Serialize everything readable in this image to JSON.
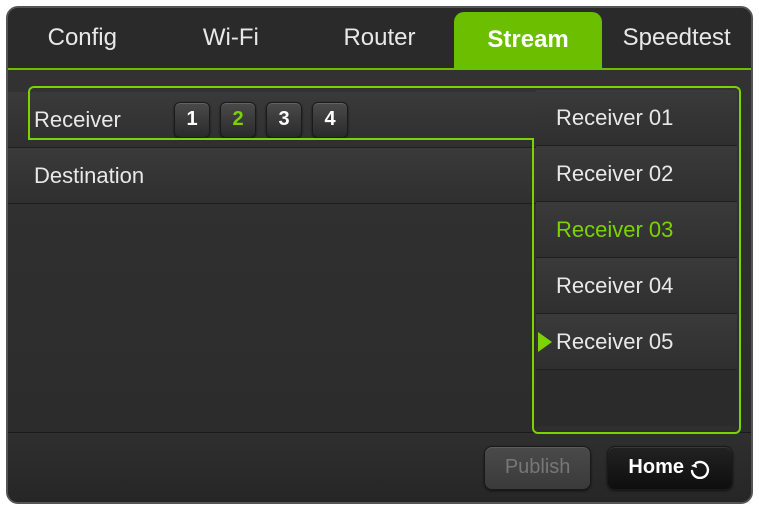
{
  "tabs": [
    {
      "label": "Config",
      "active": false
    },
    {
      "label": "Wi-Fi",
      "active": false
    },
    {
      "label": "Router",
      "active": false
    },
    {
      "label": "Stream",
      "active": true
    },
    {
      "label": "Speedtest",
      "active": false
    }
  ],
  "rows": {
    "receiver_label": "Receiver",
    "destination_label": "Destination"
  },
  "receiver_buttons": [
    {
      "label": "1",
      "active": false
    },
    {
      "label": "2",
      "active": true
    },
    {
      "label": "3",
      "active": false
    },
    {
      "label": "4",
      "active": false
    }
  ],
  "dropdown": [
    {
      "label": "Receiver 01",
      "selected": false,
      "current": false
    },
    {
      "label": "Receiver 02",
      "selected": false,
      "current": false
    },
    {
      "label": "Receiver 03",
      "selected": true,
      "current": false
    },
    {
      "label": "Receiver 04",
      "selected": false,
      "current": false
    },
    {
      "label": "Receiver 05",
      "selected": false,
      "current": true
    }
  ],
  "footer": {
    "publish_label": "Publish",
    "home_label": "Home"
  },
  "colors": {
    "accent": "#7ad400"
  }
}
